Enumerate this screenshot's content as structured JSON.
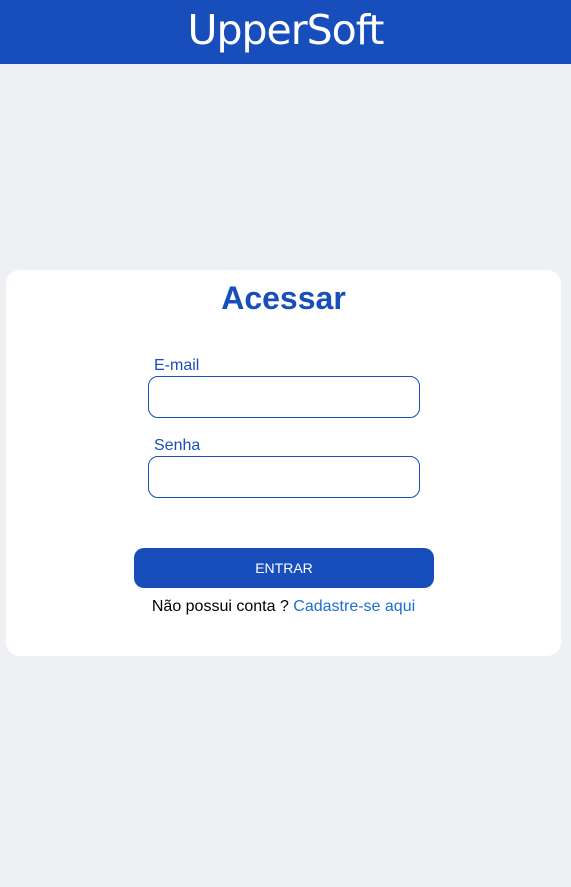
{
  "header": {
    "logo": "UpperSoft"
  },
  "login": {
    "title": "Acessar",
    "email_label": "E-mail",
    "email_value": "",
    "password_label": "Senha",
    "password_value": "",
    "submit": "ENTRAR",
    "no_account": "Não possui conta ?",
    "register_link": "Cadastre-se aqui"
  },
  "colors": {
    "brand": "#174ebb",
    "link": "#1a6ed8",
    "background": "#eff0f3"
  }
}
